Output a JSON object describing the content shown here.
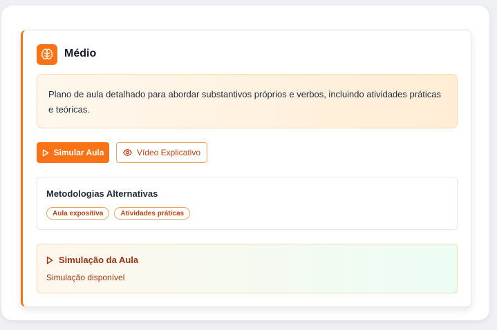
{
  "level": {
    "title": "Médio",
    "icon": "brain-icon"
  },
  "description": "Plano de aula detalhado para abordar substantivos próprios e verbos, incluindo atividades práticas e teóricas.",
  "actions": {
    "simulate_label": "Simular Aula",
    "simulate_icon": "play-icon",
    "video_label": "Vídeo Explicativo",
    "video_icon": "eye-icon"
  },
  "methodologies": {
    "title": "Metodologias Alternativas",
    "tags": [
      "Aula expositiva",
      "Atividades práticas"
    ]
  },
  "simulation": {
    "title": "Simulação da Aula",
    "status": "Simulação disponível",
    "icon": "play-icon"
  },
  "colors": {
    "accent": "#f97316",
    "accent_dark": "#c2410c",
    "simulation_text": "#9a3412"
  }
}
